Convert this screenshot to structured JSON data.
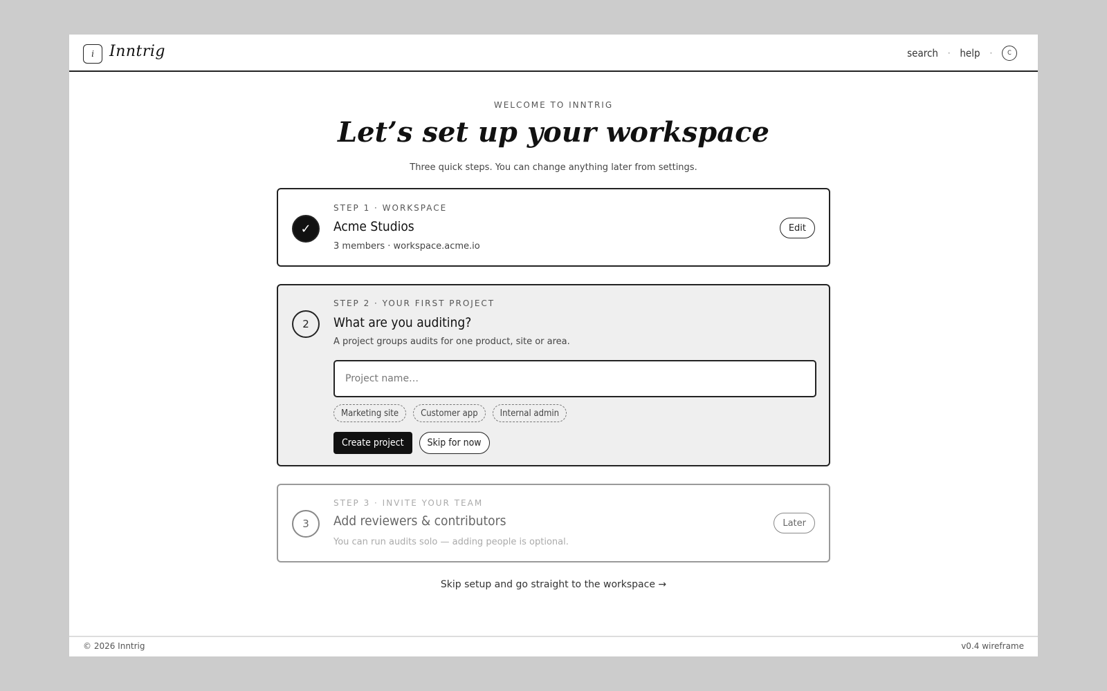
{
  "app": {
    "logo_glyph": "i",
    "name": "Inntrig"
  },
  "topnav": {
    "search": "search",
    "separator": "·",
    "help": "help",
    "avatar_initial": "C"
  },
  "hero": {
    "eyebrow": "WELCOME TO INNTRIG",
    "title": "Let’s set up your workspace",
    "subtitle": "Three quick steps. You can change anything later from settings."
  },
  "steps": [
    {
      "marker": "✓",
      "status": "completed",
      "label": "STEP 1 · WORKSPACE",
      "title": "Acme Studios",
      "description": "3 members · workspace.acme.io",
      "action": "Edit"
    },
    {
      "marker": "2",
      "status": "active",
      "label": "STEP 2 · YOUR FIRST PROJECT",
      "title": "What are you auditing?",
      "description": "A project groups audits for one product, site or area.",
      "input_placeholder": "Project name…",
      "input_value": "",
      "suggestions": [
        "Marketing site",
        "Customer app",
        "Internal admin"
      ],
      "primary_action": "Create project",
      "secondary_action": "Skip for now"
    },
    {
      "marker": "3",
      "status": "upcoming",
      "label": "STEP 3 · INVITE YOUR TEAM",
      "title": "Add reviewers & contributors",
      "description": "You can run audits solo — adding people is optional.",
      "action": "Later"
    }
  ],
  "skip_setup": "Skip setup and go straight to the workspace →",
  "footer": {
    "copyright": "© 2026 Inntrig",
    "version": "v0.4 wireframe"
  },
  "colors": {
    "page_background": "#cccccc",
    "frame_background": "#ffffff",
    "active_card_background": "#efefef",
    "primary": "#111111"
  }
}
